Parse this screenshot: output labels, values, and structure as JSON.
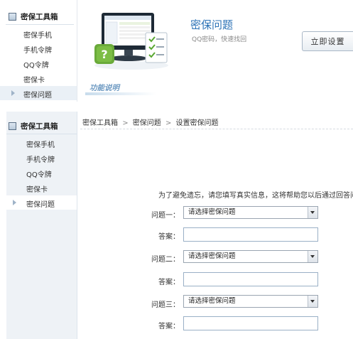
{
  "top_sidebar": {
    "header": "密保工具箱",
    "items": [
      {
        "label": "密保手机"
      },
      {
        "label": "手机令牌"
      },
      {
        "label": "QQ令牌"
      },
      {
        "label": "密保卡"
      },
      {
        "label": "密保问题",
        "active": true
      }
    ]
  },
  "top_panel": {
    "title": "密保问题",
    "subtitle": "QQ密码，快速找回",
    "setup_button": "立即设置",
    "func_desc": "功能说明"
  },
  "bottom_sidebar": {
    "header": "密保工具箱",
    "items": [
      {
        "label": "密保手机"
      },
      {
        "label": "手机令牌"
      },
      {
        "label": "QQ令牌"
      },
      {
        "label": "密保卡"
      },
      {
        "label": "密保问题",
        "active": true
      }
    ]
  },
  "breadcrumb": {
    "part1": "密保工具箱",
    "sep1": ">",
    "part2": "密保问题",
    "sep2": ">",
    "part3": "设置密保问题"
  },
  "form": {
    "intro": "为了避免遗忘，请您填写真实信息，这将帮助您以后通过回答问题",
    "questions": [
      {
        "label": "问题一：",
        "select_value": "请选择密保问题",
        "answer_label": "答案：",
        "answer_value": ""
      },
      {
        "label": "问题二：",
        "select_value": "请选择密保问题",
        "answer_label": "答案：",
        "answer_value": ""
      },
      {
        "label": "问题三：",
        "select_value": "请选择密保问题",
        "answer_label": "答案：",
        "answer_value": ""
      }
    ]
  },
  "colors": {
    "title_blue": "#2b72b6",
    "sidebar_bg": "#eef2f6",
    "active_arrow": "#9fb3c8"
  },
  "icons": [
    "book-icon",
    "monitor-illustration",
    "question-mark-icon",
    "checklist-icon",
    "chevron-down-icon",
    "triangle-right-icon"
  ]
}
